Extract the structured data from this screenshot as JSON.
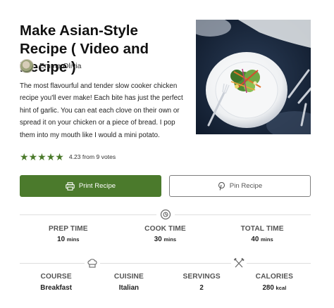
{
  "recipe": {
    "title": "Make Asian-Style Recipe ( Video and Recipe )",
    "author": "Emma Olivia",
    "description": "The most flavourful and tender slow cooker chicken recipe you'll ever make! Each bite has just the perfect hint of garlic. You can eat each clove on their own or spread it on your chicken or a piece of bread. I pop them into my mouth like I would a mini potato.",
    "rating": {
      "stars": 5,
      "text": "4.23 from 9 votes"
    }
  },
  "buttons": {
    "print_label": "Print Recipe",
    "pin_label": "Pin Recipe"
  },
  "times": [
    {
      "label": "PREP TIME",
      "value": "10",
      "unit": "mins"
    },
    {
      "label": "COOK TIME",
      "value": "30",
      "unit": "mins"
    },
    {
      "label": "TOTAL TIME",
      "value": "40",
      "unit": "mins"
    }
  ],
  "info": [
    {
      "label": "COURSE",
      "value": "Breakfast",
      "unit": ""
    },
    {
      "label": "CUISINE",
      "value": "Italian",
      "unit": ""
    },
    {
      "label": "SERVINGS",
      "value": "2",
      "unit": ""
    },
    {
      "label": "CALORIES",
      "value": "280",
      "unit": "kcal"
    }
  ],
  "icons": {
    "timer": "timer-icon",
    "chef_hat": "chef-hat-icon",
    "utensils": "utensils-icon",
    "print": "printer-icon",
    "pinterest": "pinterest-icon",
    "star": "star-icon"
  },
  "colors": {
    "accent": "#4b7a2c",
    "star": "#4a7a2a",
    "rule": "#dedede"
  }
}
